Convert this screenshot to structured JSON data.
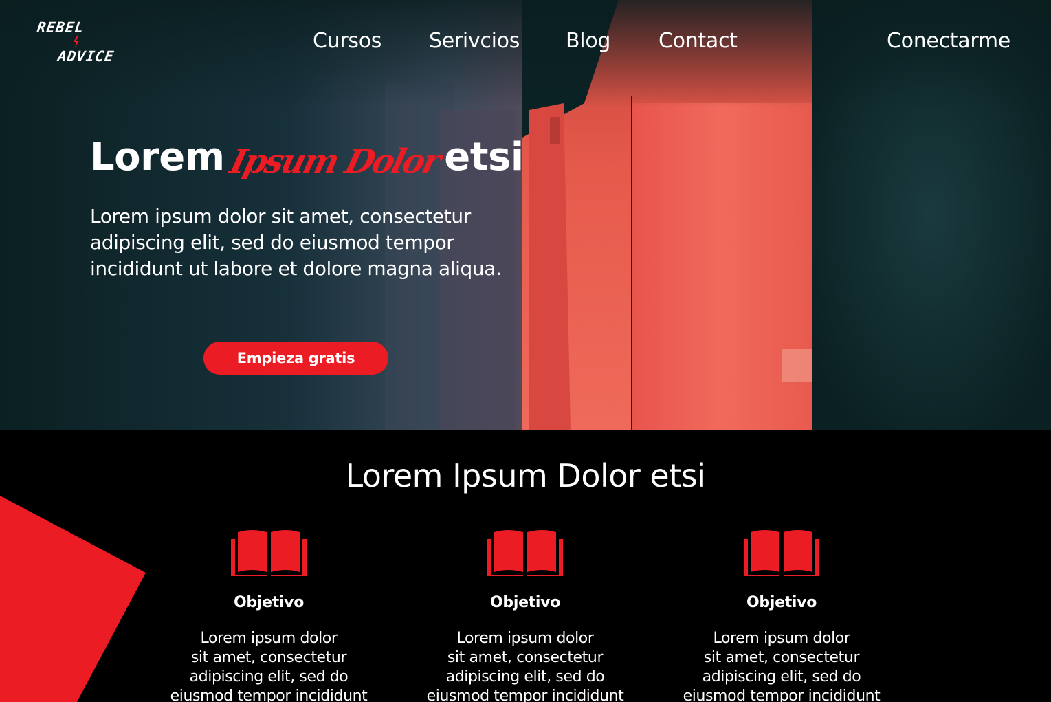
{
  "brand": {
    "logo_line1": "REBEL",
    "logo_line2": "ADVICE"
  },
  "nav": {
    "items": [
      "Cursos",
      "Serivcios",
      "Blog",
      "Contact"
    ],
    "login": "Conectarme"
  },
  "hero": {
    "title_pre": "Lorem",
    "title_script": "Ipsum Dolor",
    "title_post": "etsi",
    "text": "Lorem ipsum dolor sit amet, consectetur adipiscing elit, sed do eiusmod tempor incididunt ut labore et dolore magna aliqua.",
    "cta": "Empieza gratis"
  },
  "section": {
    "title": "Lorem Ipsum Dolor etsi",
    "features": [
      {
        "icon": "open-book-icon",
        "title": "Objetivo",
        "text": "Lorem ipsum dolor\nsit amet, consectetur\nadipiscing elit, sed do\neiusmod tempor incididunt"
      },
      {
        "icon": "open-book-icon",
        "title": "Objetivo",
        "text": "Lorem ipsum dolor\nsit amet, consectetur\nadipiscing elit, sed do\neiusmod tempor incididunt"
      },
      {
        "icon": "open-book-icon",
        "title": "Objetivo",
        "text": "Lorem ipsum dolor\nsit amet, consectetur\nadipiscing elit, sed do\neiusmod tempor incididunt"
      }
    ]
  },
  "colors": {
    "accent": "#ec1c24",
    "hero_bg": "#0a2022",
    "section_bg": "#000000",
    "text": "#ffffff"
  }
}
